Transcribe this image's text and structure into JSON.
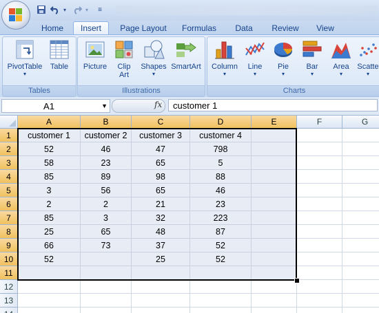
{
  "quick_access": {
    "save": "save-icon",
    "undo": "undo-icon",
    "redo": "redo-icon"
  },
  "tabs": [
    {
      "label": "Home",
      "active": false
    },
    {
      "label": "Insert",
      "active": true
    },
    {
      "label": "Page Layout",
      "active": false
    },
    {
      "label": "Formulas",
      "active": false
    },
    {
      "label": "Data",
      "active": false
    },
    {
      "label": "Review",
      "active": false
    },
    {
      "label": "View",
      "active": false
    }
  ],
  "ribbon": {
    "tables": {
      "label": "Tables",
      "pivot_table": "PivotTable",
      "table": "Table"
    },
    "illustrations": {
      "label": "Illustrations",
      "picture": "Picture",
      "clip_art_1": "Clip",
      "clip_art_2": "Art",
      "shapes": "Shapes",
      "smartart": "SmartArt"
    },
    "charts": {
      "label": "Charts",
      "column": "Column",
      "line": "Line",
      "pie": "Pie",
      "bar": "Bar",
      "area": "Area",
      "scatter": "Scatte"
    }
  },
  "formula_bar": {
    "name_box": "A1",
    "fx": "fx",
    "formula": "customer 1"
  },
  "sheet": {
    "columns": [
      "A",
      "B",
      "C",
      "D",
      "E",
      "F",
      "G"
    ],
    "rows": [
      "1",
      "2",
      "3",
      "4",
      "5",
      "6",
      "7",
      "8",
      "9",
      "10",
      "11",
      "12",
      "13",
      "14"
    ],
    "cells": [
      [
        "customer 1",
        "customer 2",
        "customer 3",
        "customer 4",
        ""
      ],
      [
        "52",
        "46",
        "47",
        "798",
        ""
      ],
      [
        "58",
        "23",
        "65",
        "5",
        ""
      ],
      [
        "85",
        "89",
        "98",
        "88",
        ""
      ],
      [
        "3",
        "56",
        "65",
        "46",
        ""
      ],
      [
        "2",
        "2",
        "21",
        "23",
        ""
      ],
      [
        "85",
        "3",
        "32",
        "223",
        ""
      ],
      [
        "25",
        "65",
        "48",
        "87",
        ""
      ],
      [
        "66",
        "73",
        "37",
        "52",
        ""
      ],
      [
        "52",
        "",
        "25",
        "52",
        ""
      ],
      [
        "",
        "",
        "",
        "",
        ""
      ]
    ]
  },
  "colors": {
    "selection_fill": "#e8ecf5",
    "header_selected": "#f1c15f",
    "ribbon_text": "#15428b"
  }
}
